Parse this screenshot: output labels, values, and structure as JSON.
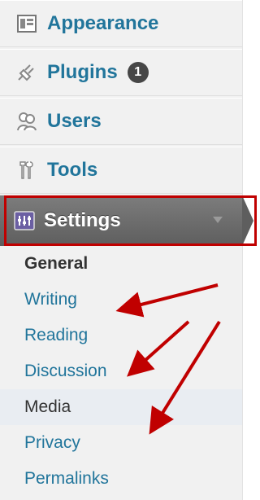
{
  "menu": {
    "items": [
      {
        "label": "Appearance",
        "icon": "appearance-icon"
      },
      {
        "label": "Plugins",
        "icon": "plugins-icon",
        "badge": "1"
      },
      {
        "label": "Users",
        "icon": "users-icon"
      },
      {
        "label": "Tools",
        "icon": "tools-icon"
      }
    ],
    "settings": {
      "label": "Settings",
      "icon": "settings-icon"
    },
    "submenu": [
      {
        "label": "General",
        "current": true
      },
      {
        "label": "Writing"
      },
      {
        "label": "Reading"
      },
      {
        "label": "Discussion"
      },
      {
        "label": "Media"
      },
      {
        "label": "Privacy"
      },
      {
        "label": "Permalinks"
      }
    ]
  },
  "colors": {
    "link": "#21759b",
    "settings_bg": "#6e6e6e",
    "annotation_red": "#c00000"
  }
}
